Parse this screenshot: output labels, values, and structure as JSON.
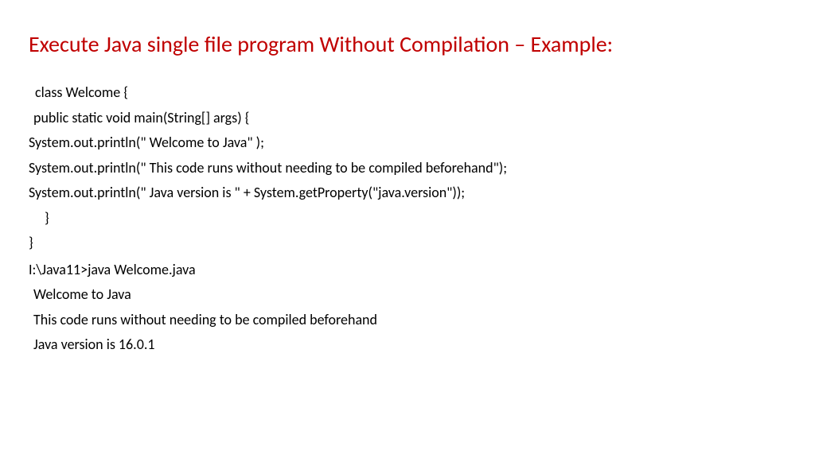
{
  "title": "Execute Java single file  program Without Compilation – Example:",
  "lines": {
    "l1": "class  Welcome {",
    "l2": "public static void main(String[] args) {",
    "l3": "System.out.println(\" Welcome to Java\" );",
    "l4": "System.out.println(\" This code runs without needing to be compiled beforehand\");",
    "l5": "System.out.println(\" Java version is  \" + System.getProperty(\"java.version\"));",
    "l6": "}",
    "l7": "}",
    "l8": "I:\\Java11>java Welcome.java",
    "l9": "Welcome to Java",
    "l10": "This code runs without needing to be compiled beforehand",
    "l11": "Java version is  16.0.1"
  }
}
